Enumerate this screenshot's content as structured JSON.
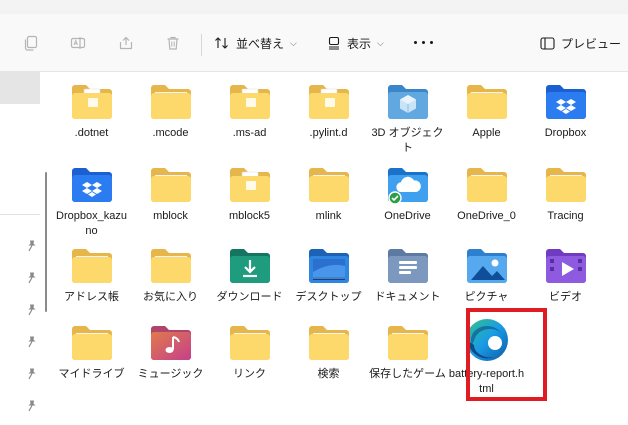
{
  "toolbar": {
    "sort_label": "並べ替え",
    "view_label": "表示",
    "preview_label": "プレビュー"
  },
  "files": [
    {
      "name": ".dotnet",
      "icon": "folder-doc"
    },
    {
      "name": ".mcode",
      "icon": "folder"
    },
    {
      "name": ".ms-ad",
      "icon": "folder-doc"
    },
    {
      "name": ".pylint.d",
      "icon": "folder-doc"
    },
    {
      "name": "3D オブジェクト",
      "icon": "folder-3d"
    },
    {
      "name": "Apple",
      "icon": "folder"
    },
    {
      "name": "Dropbox",
      "icon": "folder-dropbox"
    },
    {
      "name": "Dropbox_kazuno",
      "icon": "folder-dropbox"
    },
    {
      "name": "mblock",
      "icon": "folder"
    },
    {
      "name": "mblock5",
      "icon": "folder-doc"
    },
    {
      "name": "mlink",
      "icon": "folder"
    },
    {
      "name": "OneDrive",
      "icon": "folder-onedrive"
    },
    {
      "name": "OneDrive_0",
      "icon": "folder"
    },
    {
      "name": "Tracing",
      "icon": "folder"
    },
    {
      "name": "アドレス帳",
      "icon": "folder"
    },
    {
      "name": "お気に入り",
      "icon": "folder"
    },
    {
      "name": "ダウンロード",
      "icon": "folder-downloads"
    },
    {
      "name": "デスクトップ",
      "icon": "folder-desktop"
    },
    {
      "name": "ドキュメント",
      "icon": "folder-documents"
    },
    {
      "name": "ピクチャ",
      "icon": "folder-pictures"
    },
    {
      "name": "ビデオ",
      "icon": "folder-videos"
    },
    {
      "name": "マイドライブ",
      "icon": "folder"
    },
    {
      "name": "ミュージック",
      "icon": "folder-music"
    },
    {
      "name": "リンク",
      "icon": "folder"
    },
    {
      "name": "検索",
      "icon": "folder"
    },
    {
      "name": "保存したゲーム",
      "icon": "folder"
    },
    {
      "name": "battery-report.html",
      "icon": "edge-html",
      "highlighted": true
    }
  ],
  "colors": {
    "folder_back": "#e6b64a",
    "folder_front": "#fcd96a",
    "highlight": "#e01b22"
  }
}
